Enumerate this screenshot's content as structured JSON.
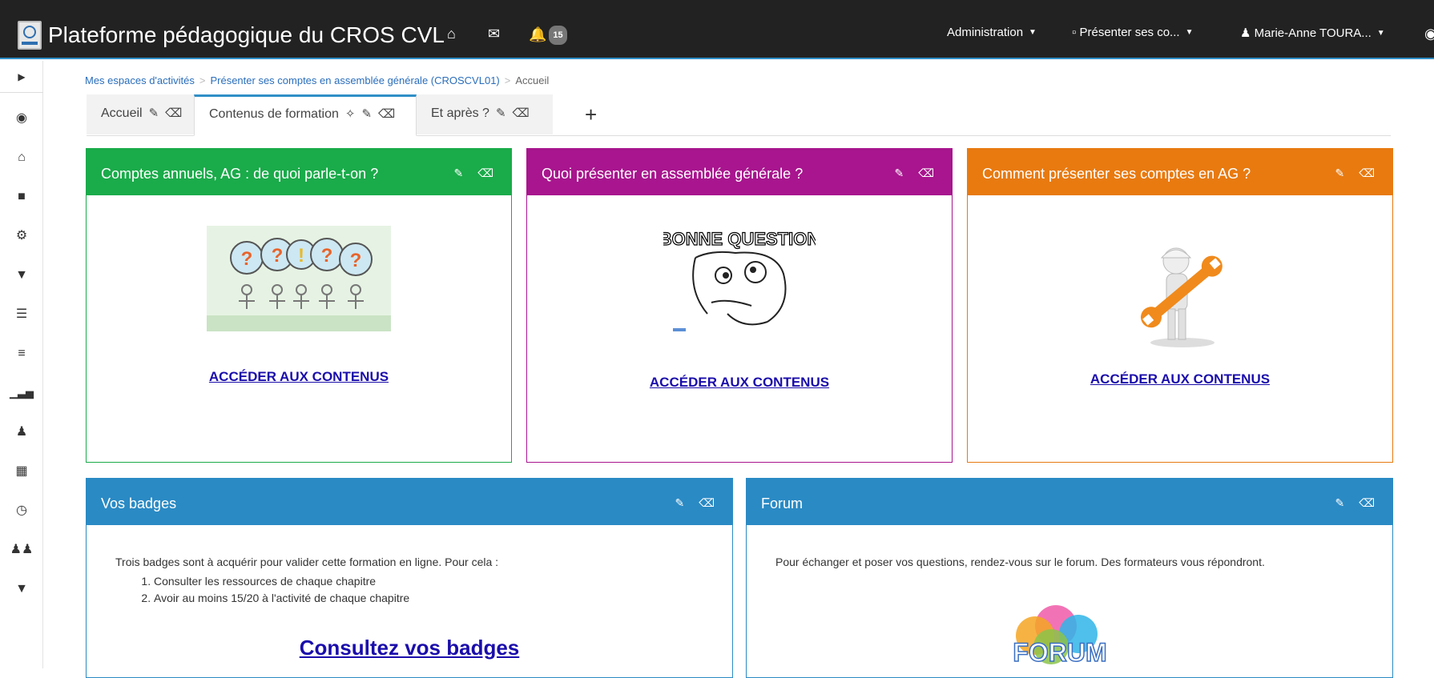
{
  "navbar": {
    "title": "Plateforme pédagogique du CROS CVL",
    "notif_count": "15",
    "menus": [
      {
        "label": "Administration"
      },
      {
        "label": "Présenter ses co..."
      },
      {
        "label": "Marie-Anne TOURA..."
      }
    ],
    "colors": {
      "bg": "#222222",
      "accent": "#2f8fc6"
    }
  },
  "sidebar": {
    "icons": [
      "caret-right-icon",
      "eye-icon",
      "home-icon",
      "folder-open-icon",
      "gear-icon",
      "trophy-icon",
      "server-icon",
      "list-icon",
      "bar-chart-icon",
      "user-icon",
      "calendar-icon",
      "clock-icon",
      "users-icon",
      "trophy-icon"
    ]
  },
  "breadcrumb": {
    "items": [
      "Mes espaces d'activités",
      "Présenter ses comptes en assemblée générale (CROSCVL01)"
    ],
    "current": "Accueil",
    "separator": ">"
  },
  "tabs": [
    {
      "label": "Accueil",
      "active": false
    },
    {
      "label": "Contenus de formation",
      "active": true
    },
    {
      "label": "Et après ?",
      "active": false
    }
  ],
  "panels": {
    "p1": {
      "title": "Comptes annuels, AG : de quoi parle-t-on ?",
      "color": "#1aab4a",
      "link": "ACCÉDER AUX CONTENUS"
    },
    "p2": {
      "title": "Quoi présenter en assemblée générale ?",
      "color": "#a8158e",
      "link": "ACCÉDER AUX CONTENUS",
      "meme_caption": "BONNE QUESTION"
    },
    "p3": {
      "title": "Comment présenter ses comptes en AG ?",
      "color": "#e87a10",
      "link": "ACCÉDER AUX CONTENUS"
    },
    "badges": {
      "title": "Vos badges",
      "color": "#2a8ac4",
      "intro": "Trois badges sont à acquérir pour valider cette formation en ligne. Pour cela :",
      "steps": [
        "Consulter les ressources de chaque chapitre",
        "Avoir au moins 15/20 à l'activité de chaque chapitre"
      ],
      "link": "Consultez vos badges"
    },
    "forum": {
      "title": "Forum",
      "color": "#2a8ac4",
      "intro": "Pour échanger et poser vos questions, rendez-vous sur le forum. Des formateurs vous répondront.",
      "logo_text": "FORUM"
    }
  }
}
